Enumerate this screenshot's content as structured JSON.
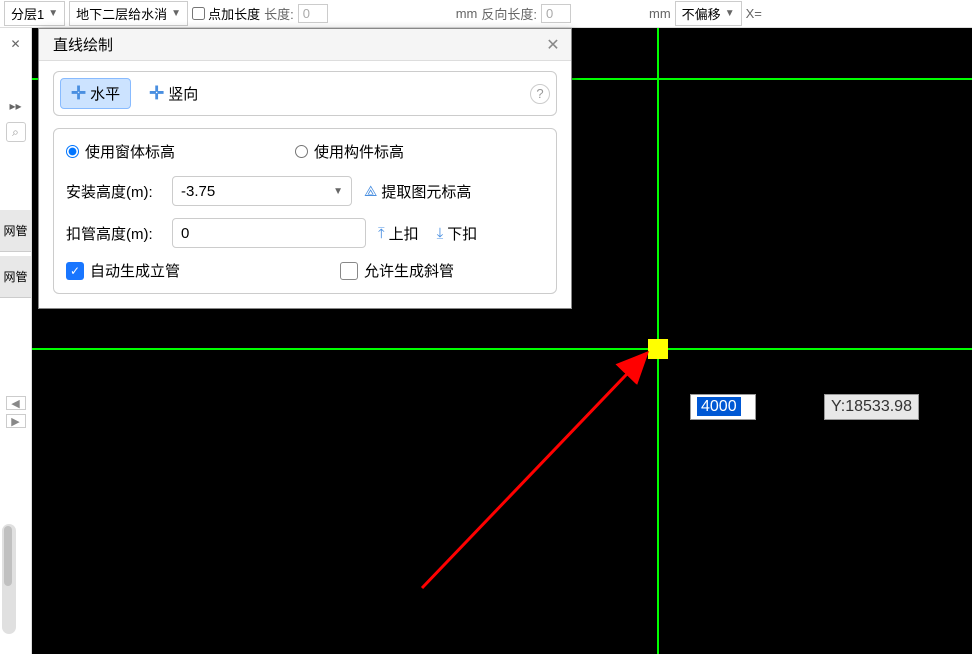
{
  "toolbar": {
    "layer_dd": "分层1",
    "scene_dd": "地下二层给水消",
    "add_len_label": "点加长度",
    "length_label": "长度:",
    "length_val": "0",
    "mm1": "mm",
    "reverse_label": "反向长度:",
    "reverse_val": "0",
    "mm2": "mm",
    "offset_dd": "不偏移",
    "x_label": "X="
  },
  "left": {
    "item1": "网管",
    "item2": "网管"
  },
  "dialog": {
    "title": "直线绘制",
    "mode_h": "水平",
    "mode_v": "竖向",
    "radio_form": "使用窗体标高",
    "radio_comp": "使用构件标高",
    "install_label": "安装高度(m):",
    "install_val": "-3.75",
    "extract_label": "提取图元标高",
    "deduct_label": "扣管高度(m):",
    "deduct_val": "0",
    "up_label": "上扣",
    "down_label": "下扣",
    "auto_label": "自动生成立管",
    "allow_label": "允许生成斜管"
  },
  "coords": {
    "x_val": "4000",
    "y_label": "Y:18533.98"
  }
}
